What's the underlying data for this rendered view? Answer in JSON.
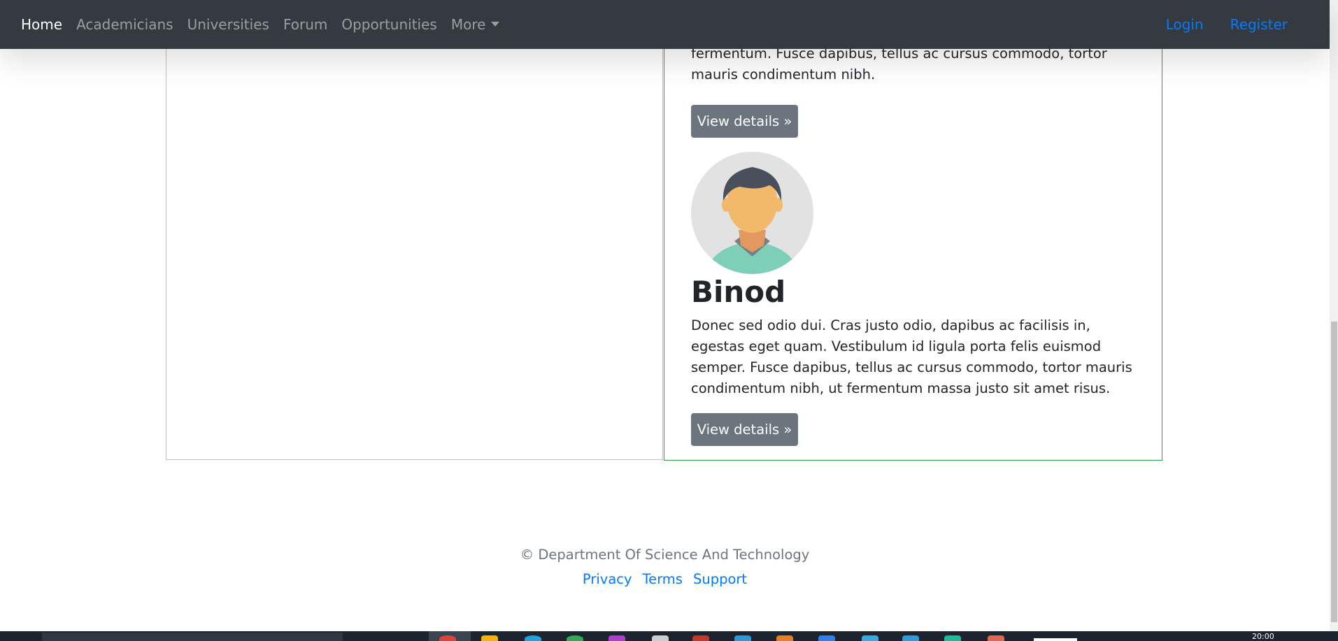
{
  "navbar": {
    "items": [
      {
        "label": "Home",
        "active": true
      },
      {
        "label": "Academicians",
        "active": false
      },
      {
        "label": "Universities",
        "active": false
      },
      {
        "label": "Forum",
        "active": false
      },
      {
        "label": "Opportunities",
        "active": false
      },
      {
        "label": "More",
        "active": false,
        "dropdown": true
      }
    ],
    "login_label": "Login",
    "register_label": "Register"
  },
  "cards": {
    "previous_text_tail": "fermentum. Fusce dapibus, tellus ac cursus commodo, tortor mauris condimentum nibh.",
    "previous_button_label": "View details »",
    "person": {
      "name": "Binod",
      "avatar_icon": "user-avatar-icon",
      "description": "Donec sed odio dui. Cras justo odio, dapibus ac facilisis in, egestas eget quam. Vestibulum id ligula porta felis euismod semper. Fusce dapibus, tellus ac cursus commodo, tortor mauris condimentum nibh, ut fermentum massa justo sit amet risus.",
      "button_label": "View details »"
    }
  },
  "footer": {
    "copyright": "© Department Of Science And Technology",
    "links": [
      "Privacy",
      "Terms",
      "Support"
    ]
  },
  "taskbar": {
    "clock": "20:00"
  },
  "colors": {
    "navbar_bg": "#343a40",
    "link_blue": "#007bff",
    "button_gray": "#6c757d",
    "left_border": "#ffc107",
    "right_border": "#28a745"
  }
}
